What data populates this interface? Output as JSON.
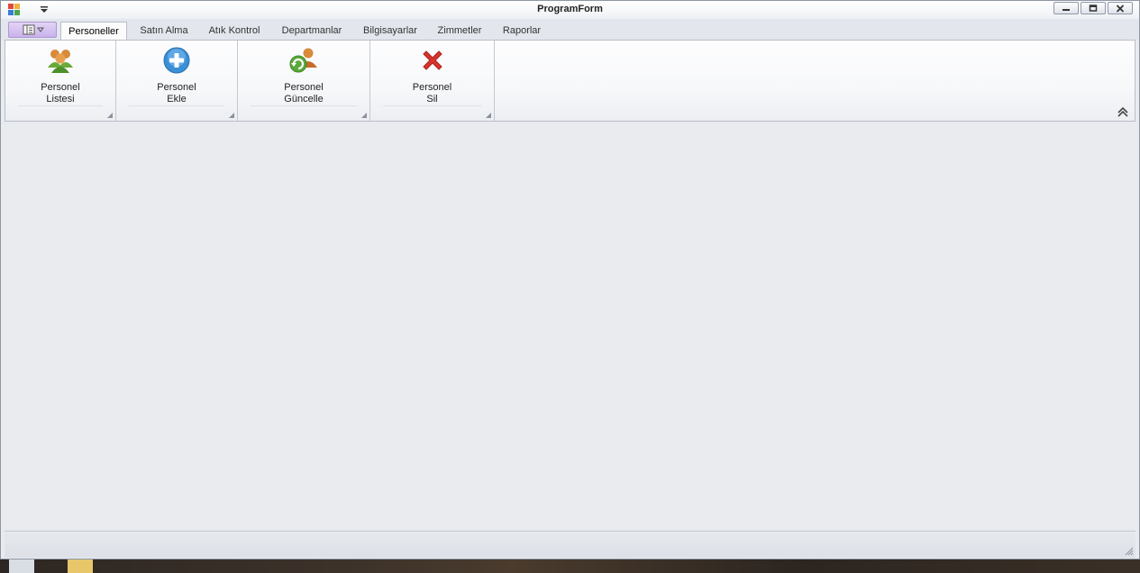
{
  "window": {
    "title": "ProgramForm"
  },
  "tabs": [
    {
      "label": "Personeller",
      "active": true
    },
    {
      "label": "Satın Alma",
      "active": false
    },
    {
      "label": "Atık Kontrol",
      "active": false
    },
    {
      "label": "Departmanlar",
      "active": false
    },
    {
      "label": "Bilgisayarlar",
      "active": false
    },
    {
      "label": "Zimmetler",
      "active": false
    },
    {
      "label": "Raporlar",
      "active": false
    }
  ],
  "ribbon": {
    "buttons": [
      {
        "line1": "Personel",
        "line2": "Listesi",
        "icon": "users-group-icon"
      },
      {
        "line1": "Personel",
        "line2": "Ekle",
        "icon": "add-circle-icon"
      },
      {
        "line1": "Personel",
        "line2": "Güncelle",
        "icon": "user-refresh-icon"
      },
      {
        "line1": "Personel",
        "line2": "Sil",
        "icon": "delete-x-icon"
      }
    ]
  },
  "colors": {
    "accent_app_button": "#c9b2ec",
    "add_icon": "#3a8fd6",
    "delete_icon": "#d8342c",
    "refresh_icon": "#5aa83a"
  }
}
